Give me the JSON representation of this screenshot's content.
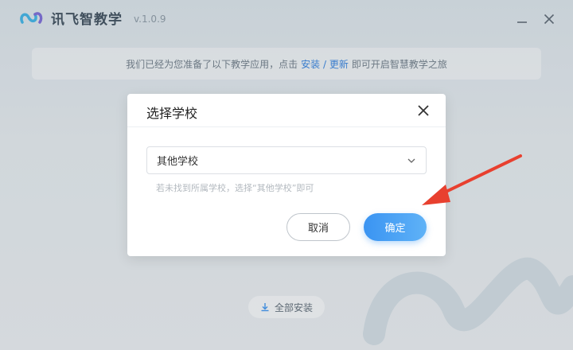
{
  "app": {
    "name": "讯飞智教学",
    "version": "v.1.0.9"
  },
  "window": {
    "minimize_icon": "minimize-icon",
    "close_icon": "close-icon"
  },
  "notice": {
    "prefix": "我们已经为您准备了以下教学应用，点击",
    "link": "安装 / 更新",
    "suffix": "即可开启智慧教学之旅"
  },
  "install_all": {
    "label": "全部安装",
    "icon": "download-icon"
  },
  "dialog": {
    "title": "选择学校",
    "select_value": "其他学校",
    "hint": "若未找到所属学校，选择“其他学校”即可",
    "cancel_label": "取消",
    "confirm_label": "确定"
  },
  "colors": {
    "accent": "#3a94f2",
    "link": "#2f7fe0",
    "arrow": "#e8402f"
  }
}
